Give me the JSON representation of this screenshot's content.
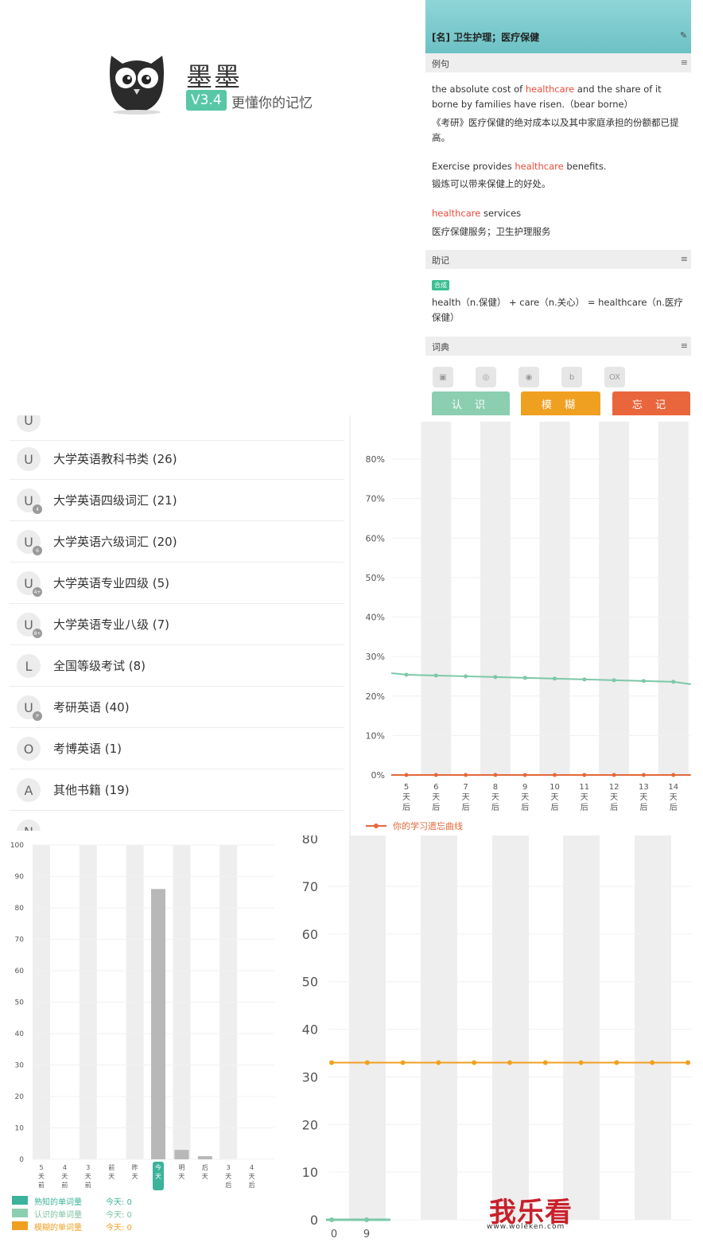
{
  "splash": {
    "app_name": "墨墨",
    "version": "V3.4",
    "slogan": "更懂你的记忆"
  },
  "word": {
    "definition": "[名] 卫生护理；医疗保健",
    "sections": {
      "examples": "例句",
      "mnemonic": "助记",
      "dictionary": "词典"
    },
    "examples": [
      {
        "en_parts": [
          "the absolute cost of ",
          "healthcare",
          " and the share of it borne by families have risen.（bear  borne）"
        ],
        "zh": "《考研》医疗保健的绝对成本以及其中家庭承担的份额都已提高。"
      },
      {
        "en_parts": [
          "Exercise provides ",
          "healthcare",
          " benefits."
        ],
        "zh": "锻炼可以带来保健上的好处。"
      },
      {
        "en_parts": [
          "",
          "healthcare",
          " services"
        ],
        "zh": "医疗保健服务；卫生护理服务"
      }
    ],
    "mnemonic_tag": "合成",
    "mnemonic_text": "health（n.保健） + care（n.关心） = healthcare（n.医疗保健）",
    "dict_icons": [
      "dict-a-icon",
      "dict-b-icon",
      "dict-c-icon",
      "bing-icon",
      "oxford-icon"
    ],
    "dict_oxford_label": "OX",
    "buttons": [
      {
        "label": "认 识",
        "color": "#8ccfb0"
      },
      {
        "label": "模 糊",
        "color": "#f0a020"
      },
      {
        "label": "忘 记",
        "color": "#e9663c"
      }
    ]
  },
  "books": [
    {
      "icon": "U",
      "sub": "",
      "label": "大学英语教科书类 (26)"
    },
    {
      "icon": "U",
      "sub": "4",
      "label": "大学英语四级词汇 (21)"
    },
    {
      "icon": "U",
      "sub": "6",
      "label": "大学英语六级词汇 (20)"
    },
    {
      "icon": "U",
      "sub": "4+",
      "label": "大学英语专业四级 (5)"
    },
    {
      "icon": "U",
      "sub": "8+",
      "label": "大学英语专业八级 (7)"
    },
    {
      "icon": "L",
      "sub": "",
      "label": "全国等级考试 (8)"
    },
    {
      "icon": "U",
      "sub": "P",
      "label": "考研英语 (40)"
    },
    {
      "icon": "O",
      "sub": "",
      "label": "考博英语 (1)"
    },
    {
      "icon": "A",
      "sub": "",
      "label": "其他书籍 (19)"
    }
  ],
  "chart_data": [
    {
      "type": "line",
      "categories": [
        "5天后",
        "6天后",
        "7天后",
        "8天后",
        "9天后",
        "10天后",
        "11天后",
        "12天后",
        "13天后",
        "14天后"
      ],
      "category_top": [
        "5",
        "6",
        "7",
        "8",
        "9",
        "10",
        "11",
        "12",
        "13",
        "14"
      ],
      "category_suffix": [
        "天",
        "后"
      ],
      "ylim": [
        0,
        80
      ],
      "yticks": [
        "0%",
        "10%",
        "20%",
        "30%",
        "40%",
        "50%",
        "60%",
        "70%",
        "80%"
      ],
      "series": [
        {
          "name": "",
          "color": "#7cc8a8",
          "values": [
            25.4,
            25.2,
            25.0,
            24.8,
            24.6,
            24.4,
            24.2,
            24.0,
            23.8,
            23.6
          ]
        },
        {
          "name": "你的学习遗忘曲线",
          "color": "#e2693c",
          "values": [
            0,
            0,
            0,
            0,
            0,
            0,
            0,
            0,
            0,
            0
          ]
        }
      ],
      "legend": "bottom-left",
      "grid": true
    },
    {
      "type": "bar",
      "categories": [
        "5天前",
        "4天前",
        "3天前",
        "前天",
        "昨天",
        "今天",
        "明天",
        "后天",
        "3天后",
        "4天后"
      ],
      "category_chars": [
        [
          "5",
          "天",
          "前"
        ],
        [
          "4",
          "天",
          "前"
        ],
        [
          "3",
          "天",
          "前"
        ],
        [
          "前",
          "天"
        ],
        [
          "昨",
          "天"
        ],
        [
          "今",
          "天"
        ],
        [
          "明",
          "天"
        ],
        [
          "后",
          "天"
        ],
        [
          "3",
          "天",
          "后"
        ],
        [
          "4",
          "天",
          "后"
        ]
      ],
      "highlight_index": 5,
      "values": [
        0,
        0,
        0,
        0,
        0,
        86,
        3,
        1,
        0,
        0
      ],
      "ylim": [
        0,
        100
      ],
      "yticks": [
        "0",
        "10",
        "20",
        "30",
        "40",
        "50",
        "60",
        "70",
        "80",
        "90",
        "100"
      ],
      "legend": "bottom-left",
      "legend_items": [
        {
          "label": "熟知的单词量",
          "value": "今天: 0",
          "color": "#3ab39a"
        },
        {
          "label": "认识的单词量",
          "value": "今天: 0",
          "color": "#8ccfb0"
        },
        {
          "label": "模糊的单词量",
          "value": "今天: 0",
          "color": "#f0a020"
        }
      ]
    },
    {
      "type": "line",
      "ylim": [
        0,
        80
      ],
      "yticks": [
        "0",
        "10",
        "20",
        "30",
        "40",
        "50",
        "60",
        "70"
      ],
      "x_labels": [
        "0",
        "9"
      ],
      "series": [
        {
          "name": "",
          "color": "#f0a020",
          "values": [
            33,
            33,
            33,
            33,
            33,
            33,
            33,
            33,
            33,
            33,
            33
          ]
        },
        {
          "name": "",
          "color": "#7cc8a8",
          "values": [
            0,
            0
          ]
        }
      ],
      "grid": true
    }
  ],
  "watermark": {
    "brand": "我乐看",
    "url": "www.woleken.com"
  }
}
